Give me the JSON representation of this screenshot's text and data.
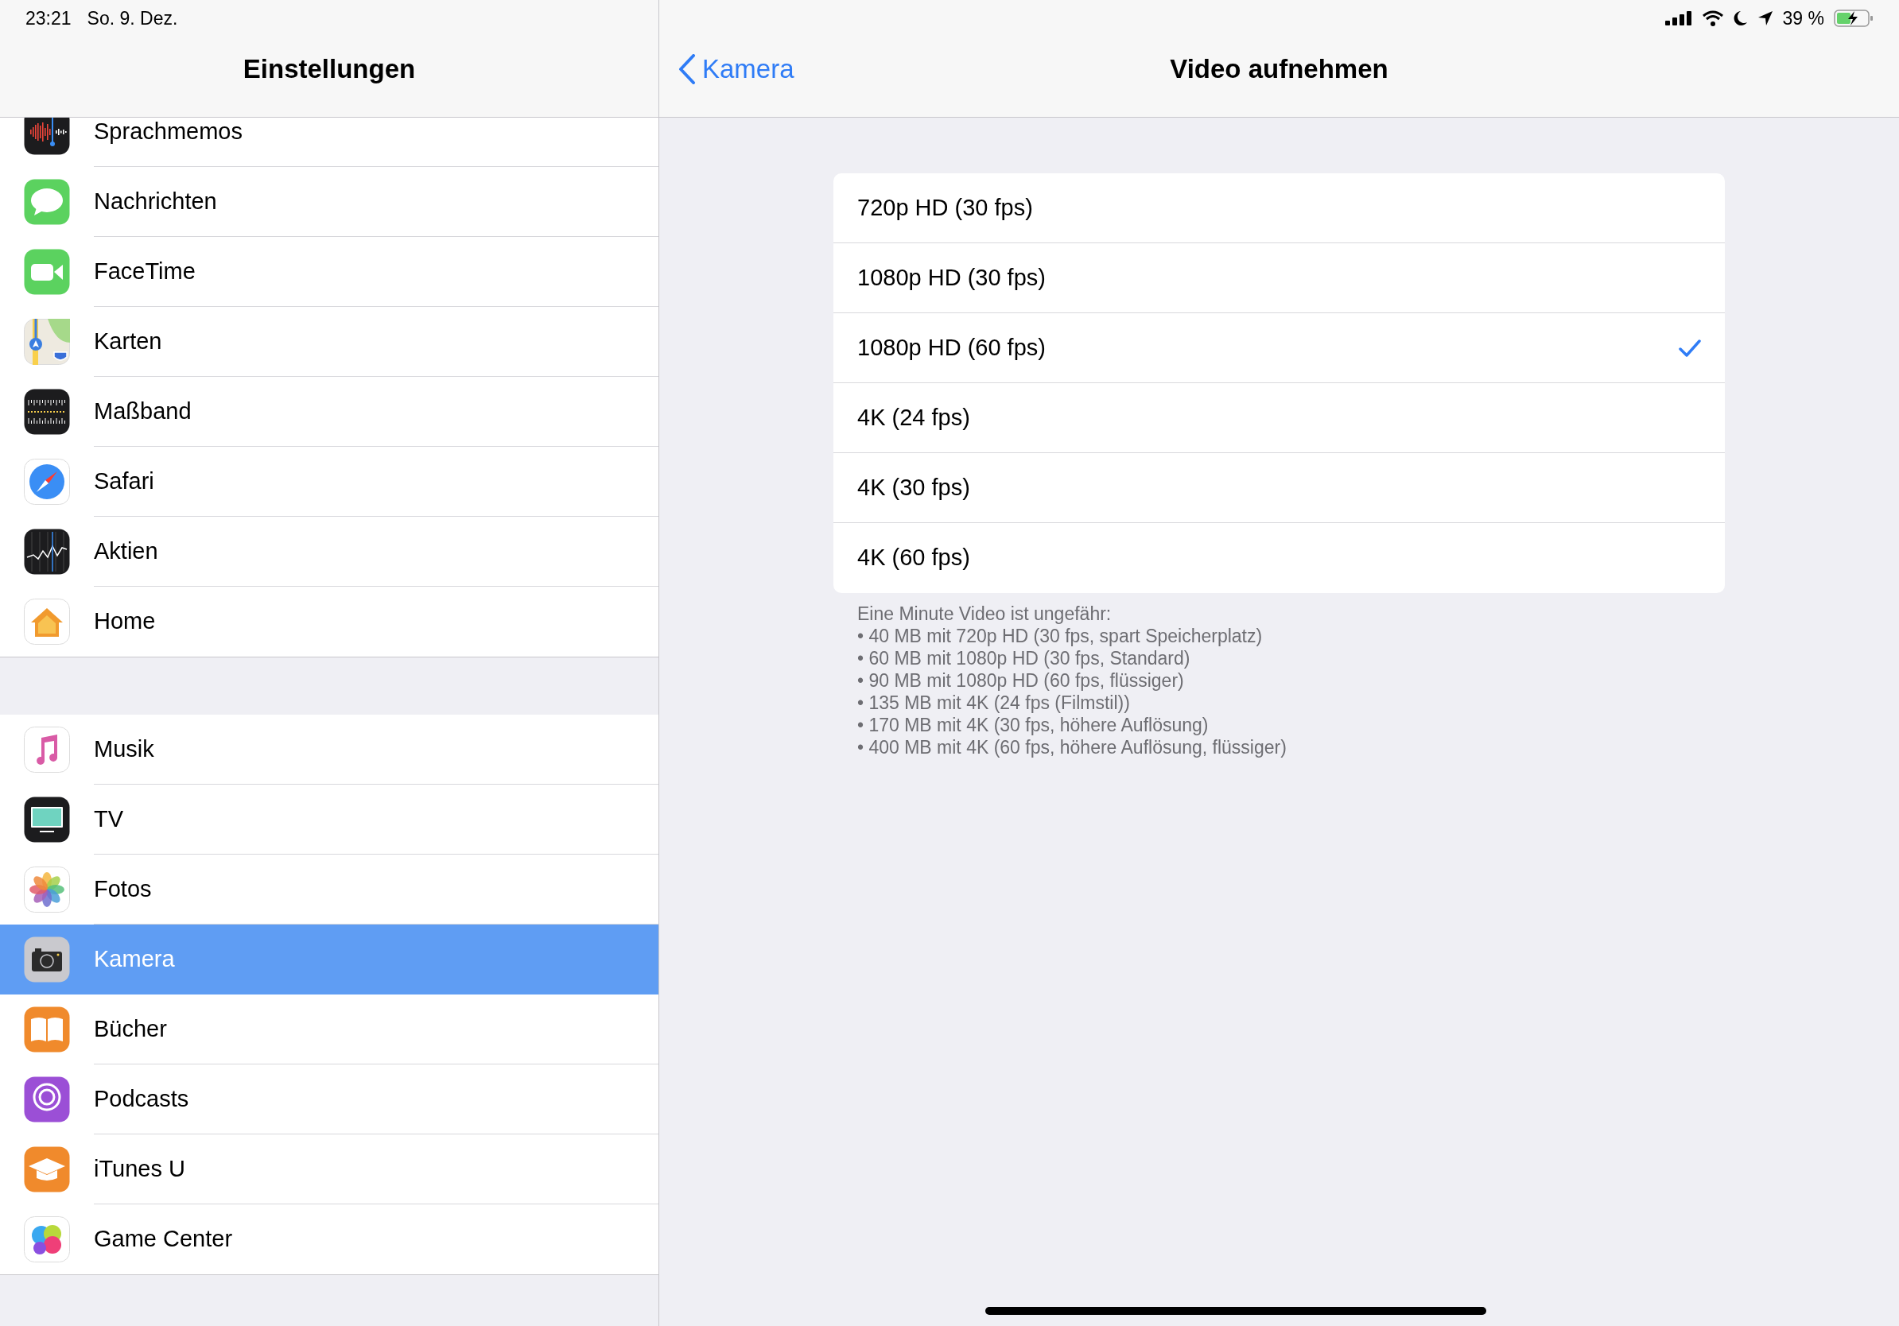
{
  "status_bar": {
    "time": "23:21",
    "date": "So. 9. Dez.",
    "battery": "39 %"
  },
  "sidebar": {
    "title": "Einstellungen",
    "groups": [
      {
        "items": [
          {
            "label": "Sprachmemos",
            "selected": false
          },
          {
            "label": "Nachrichten",
            "selected": false
          },
          {
            "label": "FaceTime",
            "selected": false
          },
          {
            "label": "Karten",
            "selected": false
          },
          {
            "label": "Maßband",
            "selected": false
          },
          {
            "label": "Safari",
            "selected": false
          },
          {
            "label": "Aktien",
            "selected": false
          },
          {
            "label": "Home",
            "selected": false
          }
        ]
      },
      {
        "items": [
          {
            "label": "Musik",
            "selected": false
          },
          {
            "label": "TV",
            "selected": false
          },
          {
            "label": "Fotos",
            "selected": false
          },
          {
            "label": "Kamera",
            "selected": true
          },
          {
            "label": "Bücher",
            "selected": false
          },
          {
            "label": "Podcasts",
            "selected": false
          },
          {
            "label": "iTunes U",
            "selected": false
          },
          {
            "label": "Game Center",
            "selected": false
          }
        ]
      }
    ]
  },
  "detail": {
    "back": "Kamera",
    "title": "Video aufnehmen",
    "options": [
      {
        "label": "720p HD (30 fps)",
        "selected": false
      },
      {
        "label": "1080p HD (30 fps)",
        "selected": false
      },
      {
        "label": "1080p HD (60 fps)",
        "selected": true
      },
      {
        "label": "4K (24 fps)",
        "selected": false
      },
      {
        "label": "4K (30 fps)",
        "selected": false
      },
      {
        "label": "4K (60 fps)",
        "selected": false
      }
    ],
    "footer": [
      "Eine Minute Video ist ungefähr:",
      "• 40 MB mit 720p HD (30 fps, spart Speicherplatz)",
      "• 60 MB mit 1080p HD (30 fps, Standard)",
      "• 90 MB mit 1080p HD (60 fps, flüssiger)",
      "• 135 MB mit 4K (24 fps (Filmstil))",
      "• 170 MB mit 4K (30 fps, höhere Auflösung)",
      "• 400 MB mit 4K (60 fps, höhere Auflösung, flüssiger)"
    ]
  }
}
